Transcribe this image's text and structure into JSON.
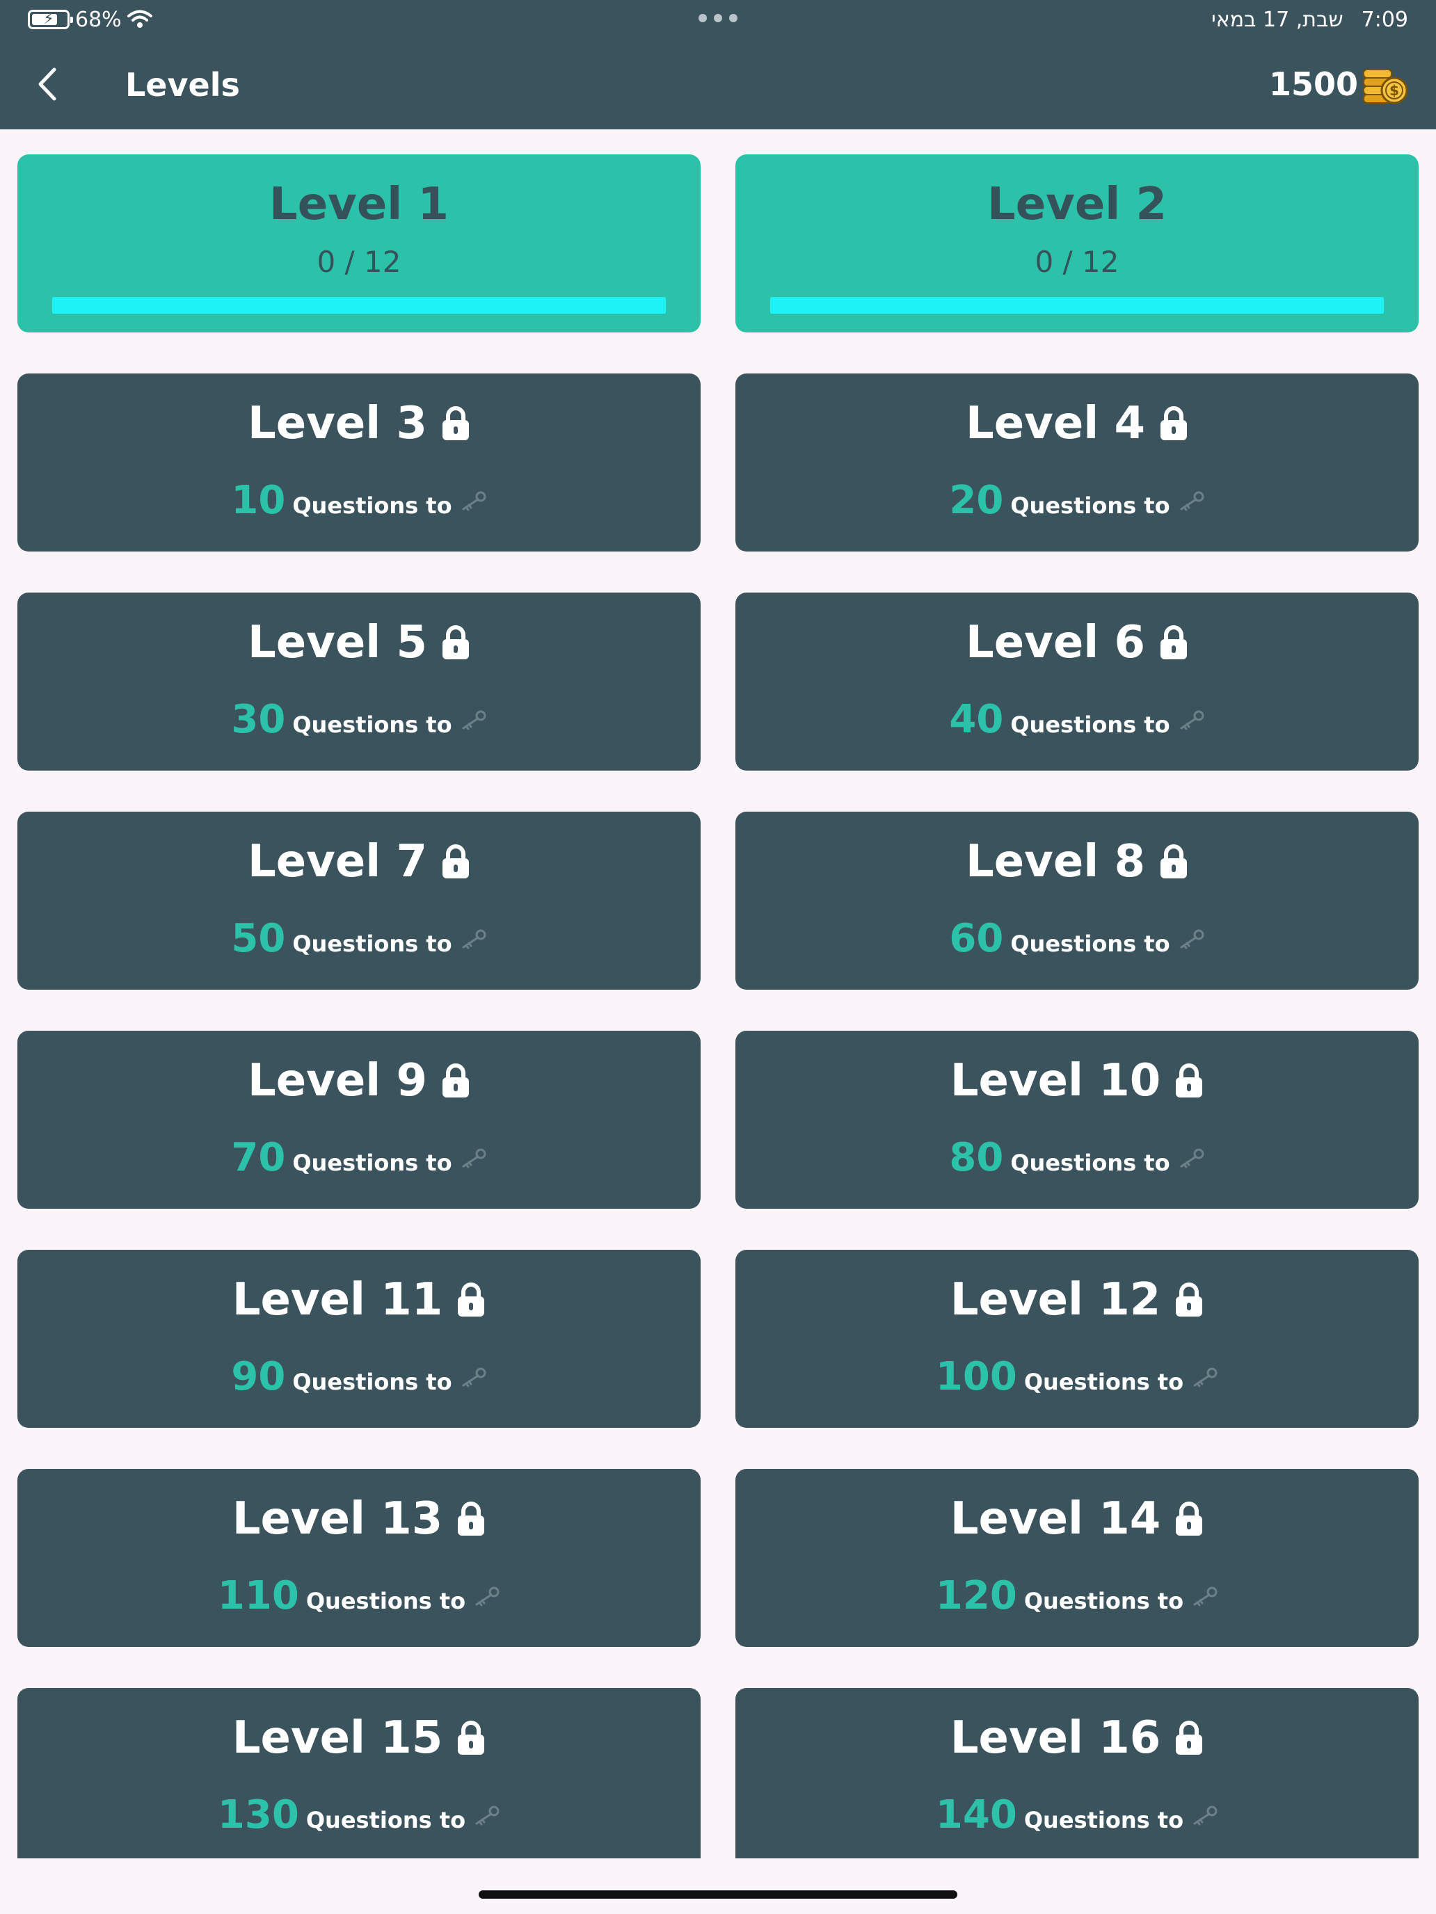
{
  "status": {
    "battery": "68%",
    "time": "7:09",
    "date": "שבת, 17 במאי"
  },
  "header": {
    "title": "Levels",
    "coins": "1500"
  },
  "levels": [
    {
      "title": "Level 1",
      "locked": false,
      "progress": "0 / 12",
      "completed": 0,
      "total": 12
    },
    {
      "title": "Level 2",
      "locked": false,
      "progress": "0 / 12",
      "completed": 0,
      "total": 12
    },
    {
      "title": "Level 3",
      "locked": true,
      "required": "10",
      "req_label": "Questions to"
    },
    {
      "title": "Level 4",
      "locked": true,
      "required": "20",
      "req_label": "Questions to"
    },
    {
      "title": "Level 5",
      "locked": true,
      "required": "30",
      "req_label": "Questions to"
    },
    {
      "title": "Level 6",
      "locked": true,
      "required": "40",
      "req_label": "Questions to"
    },
    {
      "title": "Level 7",
      "locked": true,
      "required": "50",
      "req_label": "Questions to"
    },
    {
      "title": "Level 8",
      "locked": true,
      "required": "60",
      "req_label": "Questions to"
    },
    {
      "title": "Level 9",
      "locked": true,
      "required": "70",
      "req_label": "Questions to"
    },
    {
      "title": "Level 10",
      "locked": true,
      "required": "80",
      "req_label": "Questions to"
    },
    {
      "title": "Level 11",
      "locked": true,
      "required": "90",
      "req_label": "Questions to"
    },
    {
      "title": "Level 12",
      "locked": true,
      "required": "100",
      "req_label": "Questions to"
    },
    {
      "title": "Level 13",
      "locked": true,
      "required": "110",
      "req_label": "Questions to"
    },
    {
      "title": "Level 14",
      "locked": true,
      "required": "120",
      "req_label": "Questions to"
    },
    {
      "title": "Level 15",
      "locked": true,
      "required": "130",
      "req_label": "Questions to"
    },
    {
      "title": "Level 16",
      "locked": true,
      "required": "140",
      "req_label": "Questions to"
    }
  ],
  "colors": {
    "header_bg": "#3b535c",
    "card_locked": "#3b535c",
    "card_unlocked": "#2cc2aa",
    "accent": "#2cc2aa",
    "progress_track": "#1ef2f4",
    "page_bg": "#fbf5fa"
  },
  "icons": [
    "battery-icon",
    "charging-bolt-icon",
    "wifi-icon",
    "back-chevron-icon",
    "coins-icon",
    "lock-icon",
    "key-icon"
  ]
}
